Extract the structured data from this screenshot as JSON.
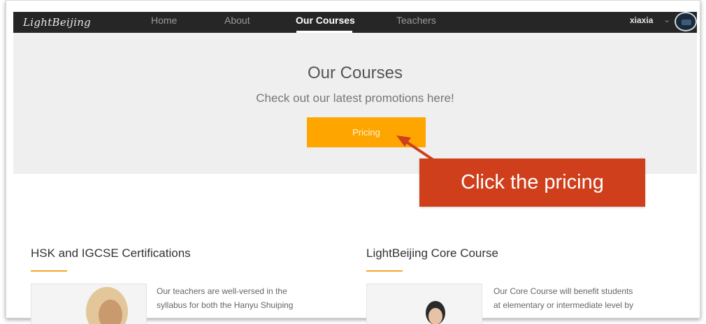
{
  "navbar": {
    "logo": "LightBeijing",
    "items": [
      {
        "label": "Home",
        "active": false
      },
      {
        "label": "About",
        "active": false
      },
      {
        "label": "Our Courses",
        "active": true
      },
      {
        "label": "Teachers",
        "active": false
      }
    ],
    "user": {
      "name": "xiaxia",
      "chevron": "⌄"
    }
  },
  "hero": {
    "title": "Our Courses",
    "subtitle": "Check out our latest promotions here!",
    "button_label": "Pricing"
  },
  "annotation": {
    "text": "Click the pricing"
  },
  "courses": [
    {
      "title": "HSK and IGCSE Certifications",
      "desc_line1": "Our teachers are well-versed in the",
      "desc_line2": "syllabus for both the Hanyu Shuiping"
    },
    {
      "title": "LightBeijing Core Course",
      "desc_line1": "Our Core Course will benefit students",
      "desc_line2": "at elementary or intermediate level by"
    }
  ],
  "colors": {
    "navbar_bg": "#262626",
    "hero_bg": "#efefef",
    "accent_orange": "#ffa500",
    "callout_red": "#cf3f1c",
    "underline_gold": "#f5a623"
  }
}
